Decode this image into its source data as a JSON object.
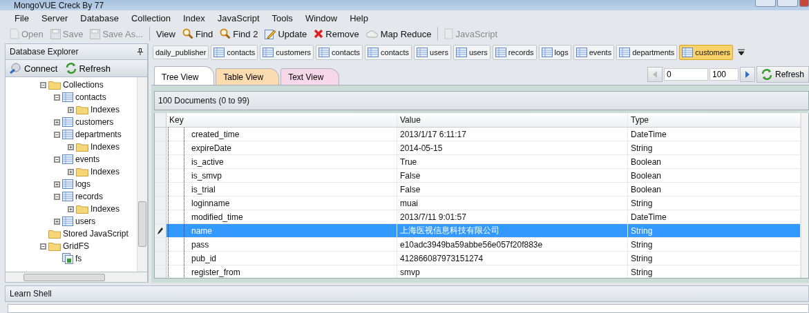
{
  "window": {
    "title": "MongoVUE Creck By 77"
  },
  "menu": [
    "File",
    "Server",
    "Database",
    "Collection",
    "Index",
    "JavaScript",
    "Tools",
    "Window",
    "Help"
  ],
  "toolbar": [
    {
      "label": "Open",
      "disabled": true
    },
    {
      "label": "Save",
      "disabled": true
    },
    {
      "label": "Save As...",
      "disabled": true
    },
    {
      "label": "View",
      "disabled": false
    },
    {
      "label": "Find",
      "disabled": false
    },
    {
      "label": "Find 2",
      "disabled": false
    },
    {
      "label": "Update",
      "disabled": false
    },
    {
      "label": "Remove",
      "disabled": false
    },
    {
      "label": "Map Reduce",
      "disabled": false
    },
    {
      "label": "JavaScript",
      "disabled": true
    }
  ],
  "sidebar": {
    "title": "Database Explorer",
    "buttons": [
      "Connect",
      "Refresh"
    ],
    "tree": [
      {
        "label": "Collections",
        "kind": "folder",
        "expanded": true,
        "children": [
          {
            "label": "contacts",
            "kind": "collection",
            "expanded": true,
            "children": [
              {
                "label": "Indexes",
                "kind": "folder",
                "expanded": false
              }
            ]
          },
          {
            "label": "customers",
            "kind": "collection",
            "expanded": false
          },
          {
            "label": "departments",
            "kind": "collection",
            "expanded": true,
            "children": [
              {
                "label": "Indexes",
                "kind": "folder",
                "expanded": false
              }
            ]
          },
          {
            "label": "events",
            "kind": "collection",
            "expanded": true,
            "children": [
              {
                "label": "Indexes",
                "kind": "folder",
                "expanded": false
              }
            ]
          },
          {
            "label": "logs",
            "kind": "collection",
            "expanded": false
          },
          {
            "label": "records",
            "kind": "collection",
            "expanded": true,
            "children": [
              {
                "label": "Indexes",
                "kind": "folder",
                "expanded": false
              }
            ]
          },
          {
            "label": "users",
            "kind": "collection",
            "expanded": false
          }
        ]
      },
      {
        "label": "Stored JavaScript",
        "kind": "folder"
      },
      {
        "label": "GridFS",
        "kind": "folder",
        "expanded": true,
        "children": [
          {
            "label": "fs",
            "kind": "gridfs"
          }
        ]
      }
    ]
  },
  "doc_tabs": [
    {
      "label": "daily_publisher",
      "selected": false
    },
    {
      "label": "contacts",
      "selected": false
    },
    {
      "label": "customers",
      "selected": false
    },
    {
      "label": "contacts",
      "selected": false
    },
    {
      "label": "contacts",
      "selected": false
    },
    {
      "label": "users",
      "selected": false
    },
    {
      "label": "users",
      "selected": false
    },
    {
      "label": "records",
      "selected": false
    },
    {
      "label": "logs",
      "selected": false
    },
    {
      "label": "events",
      "selected": false
    },
    {
      "label": "departments",
      "selected": false
    },
    {
      "label": "customers",
      "selected": true
    }
  ],
  "view_tabs": [
    {
      "label": "Tree View",
      "selected": true,
      "color": "#ffffff"
    },
    {
      "label": "Table View",
      "selected": false,
      "color": "#fbdcb0"
    },
    {
      "label": "Text View",
      "selected": false,
      "color": "#f6d8e8"
    }
  ],
  "pager": {
    "skip": "0",
    "limit": "100",
    "refresh": "Refresh"
  },
  "results": {
    "summary": "100 Documents (0 to 99)",
    "columns": [
      "Key",
      "Value",
      "Type"
    ],
    "rows": [
      {
        "key": "created_time",
        "value": "2013/1/17 6:11:17",
        "type": "DateTime",
        "selected": false
      },
      {
        "key": "expireDate",
        "value": "2014-05-15",
        "type": "String",
        "selected": false
      },
      {
        "key": "is_active",
        "value": "True",
        "type": "Boolean",
        "selected": false
      },
      {
        "key": "is_smvp",
        "value": "False",
        "type": "Boolean",
        "selected": false
      },
      {
        "key": "is_trial",
        "value": "False",
        "type": "Boolean",
        "selected": false
      },
      {
        "key": "loginname",
        "value": "muai",
        "type": "String",
        "selected": false
      },
      {
        "key": "modified_time",
        "value": "2013/7/11 9:01:57",
        "type": "DateTime",
        "selected": false
      },
      {
        "key": "name",
        "value": "上海医视信息科技有限公司",
        "type": "String",
        "selected": true
      },
      {
        "key": "pass",
        "value": "e10adc3949ba59abbe56e057f20f883e",
        "type": "String",
        "selected": false
      },
      {
        "key": "pub_id",
        "value": "412866087973151274",
        "type": "String",
        "selected": false
      },
      {
        "key": "register_from",
        "value": "smvp",
        "type": "String",
        "selected": false
      }
    ]
  },
  "shell": {
    "title": "Learn Shell"
  }
}
